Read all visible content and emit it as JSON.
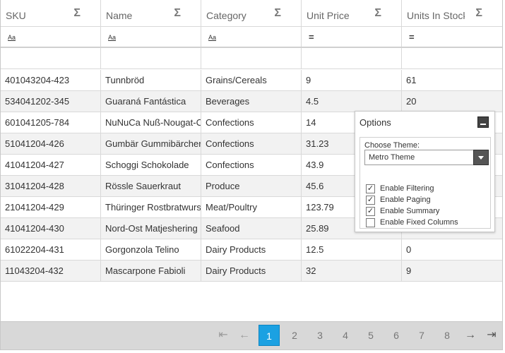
{
  "columns": [
    {
      "label": "SKU",
      "filter": "Aa"
    },
    {
      "label": "Name",
      "filter": "Aa"
    },
    {
      "label": "Category",
      "filter": "Aa"
    },
    {
      "label": "Unit Price",
      "filter": "="
    },
    {
      "label": "Units In Stock",
      "filter": "="
    }
  ],
  "sigma": "Σ",
  "rows": [
    [
      "401043204-423",
      "Tunnbröd",
      "Grains/Cereals",
      "9",
      "61"
    ],
    [
      "534041202-345",
      "Guaraná Fantástica",
      "Beverages",
      "4.5",
      "20"
    ],
    [
      "601041205-784",
      "NuNuCa Nuß-Nougat-Creme",
      "Confections",
      "14",
      ""
    ],
    [
      "51041204-426",
      "Gumbär Gummibärchen",
      "Confections",
      "31.23",
      ""
    ],
    [
      "41041204-427",
      "Schoggi Schokolade",
      "Confections",
      "43.9",
      ""
    ],
    [
      "31041204-428",
      "Rössle Sauerkraut",
      "Produce",
      "45.6",
      ""
    ],
    [
      "21041204-429",
      "Thüringer Rostbratwurst",
      "Meat/Poultry",
      "123.79",
      ""
    ],
    [
      "41041204-430",
      "Nord-Ost Matjeshering",
      "Seafood",
      "25.89",
      ""
    ],
    [
      "61022204-431",
      "Gorgonzola Telino",
      "Dairy Products",
      "12.5",
      "0"
    ],
    [
      "11043204-432",
      "Mascarpone Fabioli",
      "Dairy Products",
      "32",
      "9"
    ]
  ],
  "pager": {
    "first": "⇤",
    "prev": "←",
    "pages": [
      "1",
      "2",
      "3",
      "4",
      "5",
      "6",
      "7",
      "8"
    ],
    "current": "1",
    "next": "→",
    "last": "⇥"
  },
  "options": {
    "title": "Options",
    "theme_label": "Choose Theme:",
    "theme_value": "Metro Theme",
    "checkboxes": [
      {
        "label": "Enable Filtering",
        "checked": true
      },
      {
        "label": "Enable Paging",
        "checked": true
      },
      {
        "label": "Enable Summary",
        "checked": true
      },
      {
        "label": "Enable Fixed Columns",
        "checked": false
      }
    ]
  },
  "colors": {
    "accent": "#1ba1e2",
    "alt_row": "#f2f2f2",
    "pager_bg": "#d8d8d8"
  }
}
